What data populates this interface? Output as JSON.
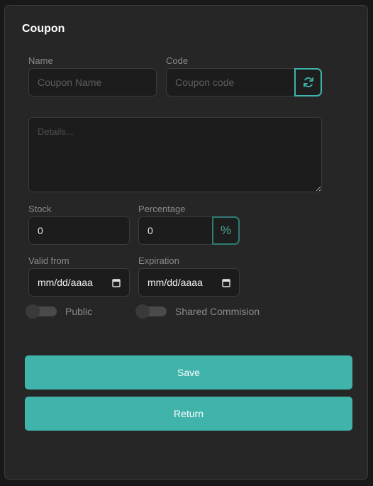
{
  "card": {
    "title": "Coupon"
  },
  "fields": {
    "name": {
      "label": "Name",
      "placeholder": "Coupon Name",
      "value": ""
    },
    "code": {
      "label": "Code",
      "placeholder": "Coupon code",
      "value": "",
      "addon_icon": "refresh-icon"
    },
    "details": {
      "placeholder": "Details...",
      "value": ""
    },
    "stock": {
      "label": "Stock",
      "value": "0"
    },
    "percentage": {
      "label": "Percentage",
      "value": "0",
      "addon_text": "%"
    },
    "valid_from": {
      "label": "Valid from",
      "value": "mm/dd/aaaa",
      "icon": "calendar-icon"
    },
    "expiration": {
      "label": "Expiration",
      "value": "mm/dd/aaaa",
      "icon": "calendar-icon"
    }
  },
  "toggles": {
    "public": {
      "label": "Public",
      "checked": false
    },
    "shared_commission": {
      "label": "Shared Commision",
      "checked": false
    }
  },
  "buttons": {
    "save": "Save",
    "return": "Return"
  },
  "colors": {
    "accent": "#40b4ab",
    "background": "#181818",
    "card": "#262626",
    "input": "#1c1c1c"
  }
}
